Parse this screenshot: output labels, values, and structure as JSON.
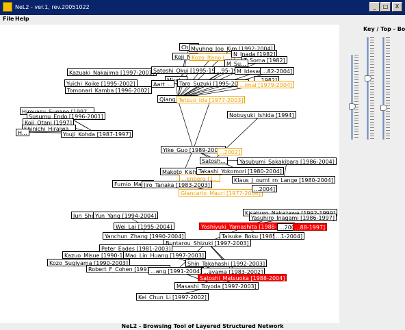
{
  "window": {
    "title": "NeL2 - ver.1, rev.20051022",
    "buttons": [
      "_",
      "□",
      "X"
    ]
  },
  "menu": [
    "File",
    "Help"
  ],
  "panel": {
    "title": "Key / Top - Bottom",
    "sliders": [
      0.62,
      0.4,
      0.7
    ]
  },
  "status": "NeL2 - Browsing Tool of Layered Structured Network",
  "colors": {
    "titlebar": "#0a246a",
    "node_border": "#000000",
    "orange": "#f0a000",
    "selected": "#ff0000",
    "slider_track": "#7090c0"
  },
  "nodes": [
    {
      "label": "Chu...",
      "cls": ""
    },
    {
      "label": "Myuhng_Joo_Kim [1992-2004]",
      "cls": ""
    },
    {
      "label": "Koji_N...",
      "cls": ""
    },
    {
      "label": "Kozo_Itano [...]",
      "cls": "orange"
    },
    {
      "label": "N_Inada [1982]",
      "cls": ""
    },
    {
      "label": "T_Soma [1982]",
      "cls": ""
    },
    {
      "label": "M_Su...",
      "cls": ""
    },
    {
      "label": "Kazuaki_Nakajima [1997-2001]",
      "cls": ""
    },
    {
      "label": "Satoshi_Okui [1995-1998]",
      "cls": ""
    },
    {
      "label": "...95-1997]",
      "cls": ""
    },
    {
      "label": "M_Idesawa [1982]",
      "cls": ""
    },
    {
      "label": "...82-2004]",
      "cls": ""
    },
    {
      "label": "Mirei...",
      "cls": ""
    },
    {
      "label": "...1982]",
      "cls": ""
    },
    {
      "label": "Yuichi_Koike [1995-2002]",
      "cls": ""
    },
    {
      "label": "Aart_...",
      "cls": ""
    },
    {
      "label": "Taro_Suzuki [1995-2002]",
      "cls": ""
    },
    {
      "label": "...imai [1979-2004]",
      "cls": "orange"
    },
    {
      "label": "Tomonari_Kamba [1996-2002]",
      "cls": ""
    },
    {
      "label": "Qiang_Li [1...",
      "cls": ""
    },
    {
      "label": "Tetsuo_Ida [1977-2003]",
      "cls": "orange"
    },
    {
      "label": "Hiroyasu_Sugano [1997...",
      "cls": ""
    },
    {
      "label": "Nobuyuki_Ishida [1994]",
      "cls": ""
    },
    {
      "label": "Susumu_Endo [1996-2001]",
      "cls": ""
    },
    {
      "label": "Koji_Otani [1997]",
      "cls": ""
    },
    {
      "label": "Shinichi_Hiraiwa...",
      "cls": ""
    },
    {
      "label": "Youji_Kohda [1987-1997]",
      "cls": ""
    },
    {
      "label": "H...",
      "cls": ""
    },
    {
      "label": "Yike_Guo [1989-2003]",
      "cls": ""
    },
    {
      "label": "...2002]",
      "cls": "orange"
    },
    {
      "label": "Satosh...",
      "cls": ""
    },
    {
      "label": "Yasubumi_Sakakibara [1986-2004]",
      "cls": ""
    },
    {
      "label": "Makoto_Kishis...",
      "cls": ""
    },
    {
      "label": "Takashi_Yokomori [1980-2004]",
      "cls": ""
    },
    {
      "label": "...enberg [1...",
      "cls": "orange"
    },
    {
      "label": "Fumio_Mats...",
      "cls": ""
    },
    {
      "label": "Jiro_Tanaka [1983-2003]",
      "cls": ""
    },
    {
      "label": "Klaus_J_ouml_rn_Lange [1980-2004]",
      "cls": ""
    },
    {
      "label": "Giancarlo_Mauri [1977-2004]",
      "cls": "orange"
    },
    {
      "label": "...2004]",
      "cls": ""
    },
    {
      "label": "Kisaburo_Nakazawa [1992-1999]",
      "cls": ""
    },
    {
      "label": "Jun_She...",
      "cls": ""
    },
    {
      "label": "Yun_Yang [1994-2004]",
      "cls": ""
    },
    {
      "label": "Yasuhiro_Inagami [1986-1997]",
      "cls": ""
    },
    {
      "label": "Wei_Lai [1995-2004]",
      "cls": ""
    },
    {
      "label": "Yoshiyuki_Yamashita [1988-2003]",
      "cls": "sel"
    },
    {
      "label": "...2004]",
      "cls": ""
    },
    {
      "label": "...88-1997]",
      "cls": "sel"
    },
    {
      "label": "Yanchun_Zhang [1990-2004]",
      "cls": ""
    },
    {
      "label": "Taisuke_Boku [1985-2004]",
      "cls": ""
    },
    {
      "label": "...1-2004]",
      "cls": ""
    },
    {
      "label": "Buntarou_Shizuki [1997-2003]",
      "cls": ""
    },
    {
      "label": "Peter_Eades [1981-2003]",
      "cls": ""
    },
    {
      "label": "Kazuo_Misue [1990-1995]",
      "cls": ""
    },
    {
      "label": "Mao_Lin_Huang [1997-2003]",
      "cls": ""
    },
    {
      "label": "Kozo_Sugiyama [1990-2003]",
      "cls": ""
    },
    {
      "label": "Shin_Takahashi [1992-2003]",
      "cls": ""
    },
    {
      "label": "Robert_F_Cohen [1991-2002]",
      "cls": ""
    },
    {
      "label": "...ang [1991-2004]",
      "cls": ""
    },
    {
      "label": "...ayama [1983-2002]",
      "cls": ""
    },
    {
      "label": "Satoshi_Matsuoka [1988-2004]",
      "cls": "sel"
    },
    {
      "label": "Masashi_Toyoda [1997-2003]",
      "cls": ""
    },
    {
      "label": "Kei_Chun_Li [1997-2002]",
      "cls": ""
    }
  ]
}
